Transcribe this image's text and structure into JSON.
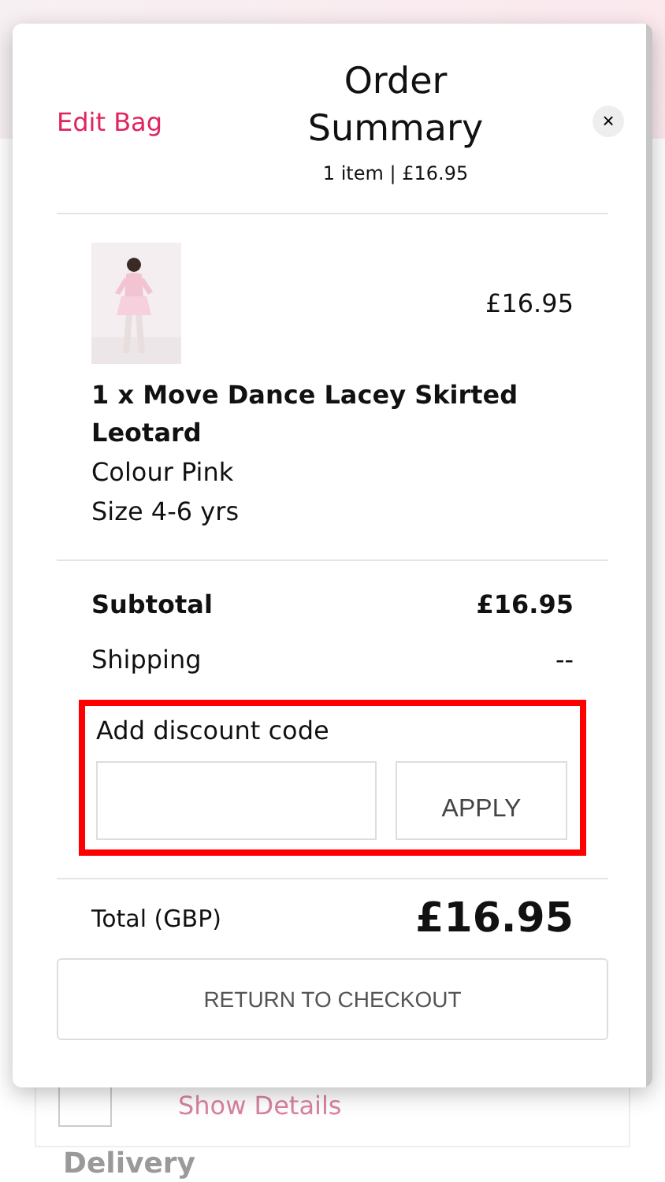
{
  "modal": {
    "edit_link": "Edit Bag",
    "title": "Order Summary",
    "subtitle": "1 item | £16.95",
    "close": "×"
  },
  "item": {
    "price": "£16.95",
    "name": "1 x Move Dance Lacey Skirted Leotard",
    "details": [
      "Colour Pink",
      "Size 4-6 yrs"
    ]
  },
  "totals": [
    {
      "label": "Subtotal",
      "value": "£16.95",
      "bold": true
    },
    {
      "label": "Shipping",
      "value": "--",
      "bold": false
    }
  ],
  "discount": {
    "label": "Add discount code",
    "button": "APPLY",
    "highlighted": true
  },
  "total": {
    "label": "Total (GBP)",
    "value": "£16.95"
  },
  "return_button": "RETURN TO CHECKOUT",
  "background": {
    "link": "Show Details",
    "heading": "Delivery"
  }
}
